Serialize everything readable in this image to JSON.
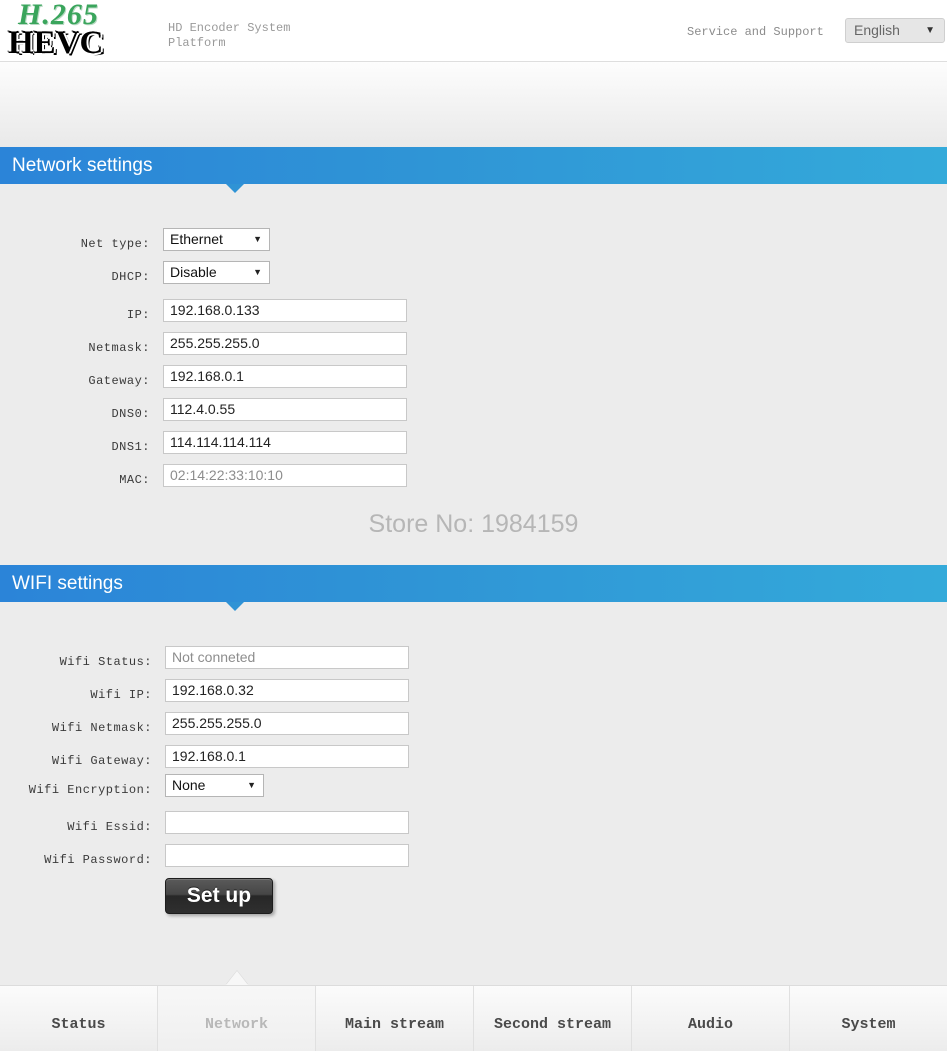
{
  "header": {
    "logo_top": "H.265",
    "logo_bottom": "HEVC",
    "subtitle": "HD Encoder System Platform",
    "service_link": "Service and Support",
    "language": {
      "selected": "English",
      "arrow": "chevron-down-icon"
    }
  },
  "page_title": "Network Settings",
  "network_section": {
    "heading": "Network settings",
    "fields": [
      {
        "label": "Net type:",
        "value": "Ethernet",
        "type": "select",
        "disabled": false
      },
      {
        "label": "DHCP:",
        "value": "Disable",
        "type": "select",
        "disabled": false
      },
      {
        "label": "IP:",
        "value": "192.168.0.133",
        "type": "text",
        "disabled": false
      },
      {
        "label": "Netmask:",
        "value": "255.255.255.0",
        "type": "text",
        "disabled": false
      },
      {
        "label": "Gateway:",
        "value": "192.168.0.1",
        "type": "text",
        "disabled": false
      },
      {
        "label": "DNS0:",
        "value": "112.4.0.55",
        "type": "text",
        "disabled": false
      },
      {
        "label": "DNS1:",
        "value": "114.114.114.114",
        "type": "text",
        "disabled": false
      },
      {
        "label": "MAC:",
        "value": "02:14:22:33:10:10",
        "type": "text",
        "disabled": true
      }
    ],
    "store_no": "Store No: 1984159"
  },
  "wifi_section": {
    "heading": "WIFI settings",
    "fields": [
      {
        "label": "Wifi Status:",
        "value": "Not conneted",
        "type": "text",
        "disabled": true
      },
      {
        "label": "Wifi IP:",
        "value": "192.168.0.32",
        "type": "text",
        "disabled": false
      },
      {
        "label": "Wifi Netmask:",
        "value": "255.255.255.0",
        "type": "text",
        "disabled": false
      },
      {
        "label": "Wifi Gateway:",
        "value": "192.168.0.1",
        "type": "text",
        "disabled": false
      },
      {
        "label": "Wifi Encryption:",
        "value": "None",
        "type": "select",
        "disabled": false
      },
      {
        "label": "Wifi Essid:",
        "value": "",
        "type": "text",
        "disabled": false
      },
      {
        "label": "Wifi Password:",
        "value": "",
        "type": "text",
        "disabled": false
      }
    ],
    "setup_button": "Set up"
  },
  "bottom_nav": {
    "items": [
      {
        "label": "Status",
        "active": false
      },
      {
        "label": "Network",
        "active": true
      },
      {
        "label": "Main stream",
        "active": false
      },
      {
        "label": "Second stream",
        "active": false
      },
      {
        "label": "Audio",
        "active": false
      },
      {
        "label": "System",
        "active": false
      }
    ]
  },
  "colors": {
    "section_bar_left": "#2b84d8",
    "section_bar_right": "#34aada",
    "logo_green": "#3aa55c",
    "panel_bg": "#ececec"
  }
}
